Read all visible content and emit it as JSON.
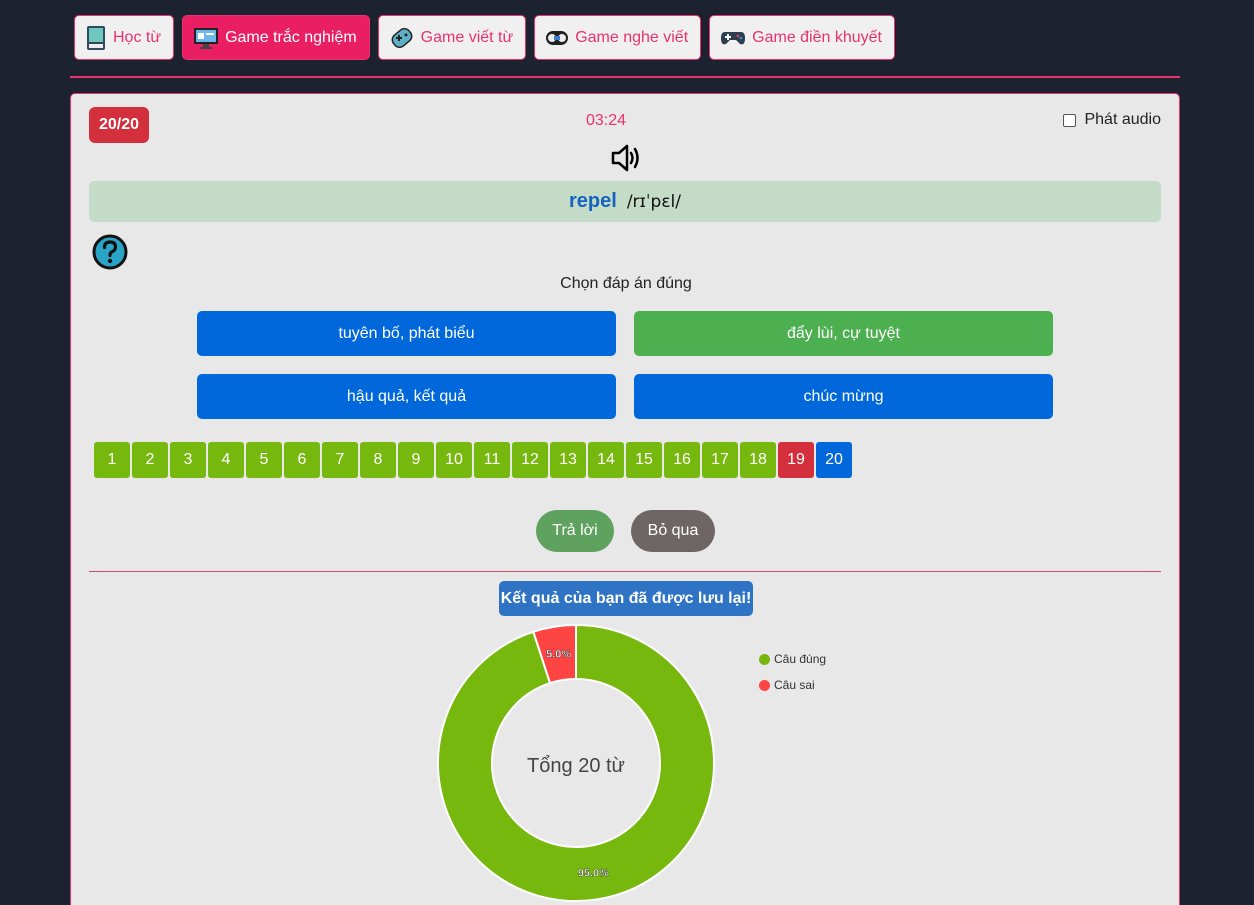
{
  "nav": {
    "tabs": [
      {
        "label": "Học từ",
        "icon": "book-icon",
        "active": false
      },
      {
        "label": "Game trắc nghiệm",
        "icon": "monitor-icon",
        "active": true
      },
      {
        "label": "Game viết từ",
        "icon": "gamepad-icon",
        "active": false
      },
      {
        "label": "Game nghe viết",
        "icon": "joystick-icon",
        "active": false
      },
      {
        "label": "Game điền khuyết",
        "icon": "controller-icon",
        "active": false
      }
    ]
  },
  "quiz": {
    "counter": "20/20",
    "timer": "03:24",
    "audio_label": "Phát audio",
    "word": "repel",
    "ipa": "/rɪˈpɛl/",
    "prompt": "Chọn đáp án đúng",
    "answers": [
      {
        "label": "tuyên bố, phát biểu",
        "state": "default"
      },
      {
        "label": "đẩy lùi, cự tuyệt",
        "state": "correct"
      },
      {
        "label": "hậu quả, kết quả",
        "state": "default"
      },
      {
        "label": "chúc mừng",
        "state": "default"
      }
    ],
    "questions": [
      {
        "label": "1",
        "state": "correct"
      },
      {
        "label": "2",
        "state": "correct"
      },
      {
        "label": "3",
        "state": "correct"
      },
      {
        "label": "4",
        "state": "correct"
      },
      {
        "label": "5",
        "state": "correct"
      },
      {
        "label": "6",
        "state": "correct"
      },
      {
        "label": "7",
        "state": "correct"
      },
      {
        "label": "8",
        "state": "correct"
      },
      {
        "label": "9",
        "state": "correct"
      },
      {
        "label": "10",
        "state": "correct"
      },
      {
        "label": "11",
        "state": "correct"
      },
      {
        "label": "12",
        "state": "correct"
      },
      {
        "label": "13",
        "state": "correct"
      },
      {
        "label": "14",
        "state": "correct"
      },
      {
        "label": "15",
        "state": "correct"
      },
      {
        "label": "16",
        "state": "correct"
      },
      {
        "label": "17",
        "state": "correct"
      },
      {
        "label": "18",
        "state": "correct"
      },
      {
        "label": "19",
        "state": "wrong"
      },
      {
        "label": "20",
        "state": "current"
      }
    ],
    "answer_button": "Trả lời",
    "skip_button": "Bỏ qua",
    "saved_message": "Kết quả của bạn đã được lưu lại!"
  },
  "colors": {
    "accent": "#e91e63",
    "correct": "#77b80e",
    "wrong": "#ff4444",
    "primary": "#0068da"
  },
  "chart_data": {
    "type": "pie",
    "donut": true,
    "center_label": "Tổng 20 từ",
    "categories": [
      "Câu đúng",
      "Câu sai"
    ],
    "values": [
      95.0,
      5.0
    ],
    "value_labels": [
      "95.0%",
      "5.0%"
    ],
    "colors": [
      "#77b80e",
      "#ff4444"
    ],
    "legend_position": "right"
  }
}
